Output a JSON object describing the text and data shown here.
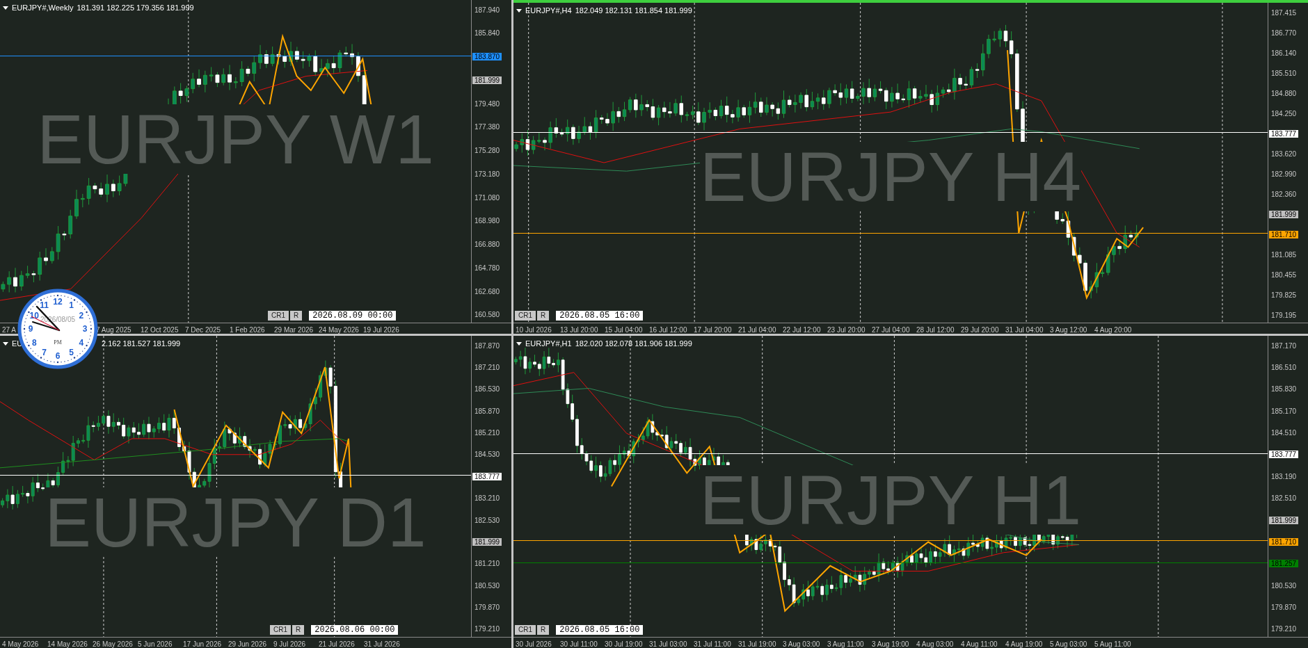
{
  "clock": {
    "date": "2026/08/05",
    "period": "PM",
    "numerals": [
      "12",
      "11",
      "1",
      "10",
      "2",
      "9",
      "3",
      "8",
      "4",
      "7",
      "5",
      "6"
    ]
  },
  "panels": [
    {
      "symbol": "EURJPY#,Weekly",
      "ohlc": "181.391 182.225 179.356 181.999",
      "watermark": "EURJPY W1",
      "active": false,
      "price_axis": [
        {
          "kind": "tick",
          "text": "187.940"
        },
        {
          "kind": "tick",
          "text": "185.840"
        },
        {
          "kind": "level",
          "text": "183.870",
          "color": "#1e90ff"
        },
        {
          "kind": "price",
          "text": "181.999",
          "color": "#c0c0c0"
        },
        {
          "kind": "tick",
          "text": "179.480"
        },
        {
          "kind": "tick",
          "text": "177.380"
        },
        {
          "kind": "tick",
          "text": "175.280"
        },
        {
          "kind": "tick",
          "text": "173.180"
        },
        {
          "kind": "tick",
          "text": "171.080"
        },
        {
          "kind": "tick",
          "text": "168.980"
        },
        {
          "kind": "tick",
          "text": "166.880"
        },
        {
          "kind": "tick",
          "text": "164.780"
        },
        {
          "kind": "tick",
          "text": "162.680"
        },
        {
          "kind": "tick",
          "text": "160.580"
        }
      ],
      "time_axis": [
        "27 A",
        "7 Aug 2025",
        "12 Oct 2025",
        "7 Dec 2025",
        "1 Feb 2026",
        "29 Mar 2026",
        "24 May 2026",
        "19 Jul 2026"
      ],
      "controls": {
        "buttons": [
          "CR1",
          "R"
        ],
        "date": "2026.08.09 00:00"
      }
    },
    {
      "symbol": "EURJPY#,H4",
      "ohlc": "182.049 182.131 181.854 181.999",
      "watermark": "EURJPY H4",
      "active": true,
      "price_axis": [
        {
          "kind": "tick",
          "text": "187.415"
        },
        {
          "kind": "tick",
          "text": "186.770"
        },
        {
          "kind": "tick",
          "text": "186.140"
        },
        {
          "kind": "tick",
          "text": "185.510"
        },
        {
          "kind": "tick",
          "text": "184.880"
        },
        {
          "kind": "tick",
          "text": "184.250"
        },
        {
          "kind": "level",
          "text": "183.777",
          "color": "#ffffff"
        },
        {
          "kind": "tick",
          "text": "183.620"
        },
        {
          "kind": "tick",
          "text": "182.990"
        },
        {
          "kind": "tick",
          "text": "182.360"
        },
        {
          "kind": "price",
          "text": "181.999",
          "color": "#c0c0c0"
        },
        {
          "kind": "level",
          "text": "181.710",
          "color": "#ffa500"
        },
        {
          "kind": "tick",
          "text": "181.085"
        },
        {
          "kind": "tick",
          "text": "180.455"
        },
        {
          "kind": "tick",
          "text": "179.825"
        },
        {
          "kind": "tick",
          "text": "179.195"
        }
      ],
      "time_axis": [
        "10 Jul 2026",
        "13 Jul 20:00",
        "15 Jul 04:00",
        "16 Jul 12:00",
        "17 Jul 20:00",
        "21 Jul 04:00",
        "22 Jul 12:00",
        "23 Jul 20:00",
        "27 Jul 04:00",
        "28 Jul 12:00",
        "29 Jul 20:00",
        "31 Jul 04:00",
        "3 Aug 12:00",
        "4 Aug 20:00"
      ],
      "controls": {
        "buttons": [
          "CR1",
          "R"
        ],
        "date": "2026.08.05 16:00"
      }
    },
    {
      "symbol": "EU",
      "ohlc": "2.162 181.527 181.999",
      "watermark": "EURJPY D1",
      "active": false,
      "price_axis": [
        {
          "kind": "tick",
          "text": "187.870"
        },
        {
          "kind": "tick",
          "text": "187.210"
        },
        {
          "kind": "tick",
          "text": "186.530"
        },
        {
          "kind": "tick",
          "text": "185.870"
        },
        {
          "kind": "tick",
          "text": "185.210"
        },
        {
          "kind": "tick",
          "text": "184.530"
        },
        {
          "kind": "level",
          "text": "183.777",
          "color": "#ffffff"
        },
        {
          "kind": "tick",
          "text": "183.210"
        },
        {
          "kind": "tick",
          "text": "182.530"
        },
        {
          "kind": "price",
          "text": "181.999",
          "color": "#c0c0c0"
        },
        {
          "kind": "tick",
          "text": "181.210"
        },
        {
          "kind": "tick",
          "text": "180.530"
        },
        {
          "kind": "tick",
          "text": "179.870"
        },
        {
          "kind": "tick",
          "text": "179.210"
        }
      ],
      "time_axis": [
        "4 May 2026",
        "14 May 2026",
        "26 May 2026",
        "5 Jun 2026",
        "17 Jun 2026",
        "29 Jun 2026",
        "9 Jul 2026",
        "21 Jul 2026",
        "31 Jul 2026"
      ],
      "controls": {
        "buttons": [
          "CR1",
          "R"
        ],
        "date": "2026.08.06 00:00"
      }
    },
    {
      "symbol": "EURJPY#,H1",
      "ohlc": "182.020 182.078 181.906 181.999",
      "watermark": "EURJPY H1",
      "active": false,
      "price_axis": [
        {
          "kind": "tick",
          "text": "187.170"
        },
        {
          "kind": "tick",
          "text": "186.510"
        },
        {
          "kind": "tick",
          "text": "185.830"
        },
        {
          "kind": "tick",
          "text": "185.170"
        },
        {
          "kind": "tick",
          "text": "184.510"
        },
        {
          "kind": "level",
          "text": "183.777",
          "color": "#ffffff"
        },
        {
          "kind": "tick",
          "text": "183.190"
        },
        {
          "kind": "tick",
          "text": "182.510"
        },
        {
          "kind": "price",
          "text": "181.999",
          "color": "#c0c0c0"
        },
        {
          "kind": "level",
          "text": "181.710",
          "color": "#ffa500"
        },
        {
          "kind": "level",
          "text": "181.257",
          "color": "#008000"
        },
        {
          "kind": "tick",
          "text": "180.530"
        },
        {
          "kind": "tick",
          "text": "179.870"
        },
        {
          "kind": "tick",
          "text": "179.210"
        }
      ],
      "time_axis": [
        "30 Jul 2026",
        "30 Jul 11:00",
        "30 Jul 19:00",
        "31 Jul 03:00",
        "31 Jul 11:00",
        "31 Jul 19:00",
        "3 Aug 03:00",
        "3 Aug 11:00",
        "3 Aug 19:00",
        "4 Aug 03:00",
        "4 Aug 11:00",
        "4 Aug 19:00",
        "5 Aug 03:00",
        "5 Aug 11:00"
      ],
      "controls": {
        "buttons": [
          "CR1",
          "R"
        ],
        "date": "2026.08.05 16:00"
      }
    }
  ]
}
